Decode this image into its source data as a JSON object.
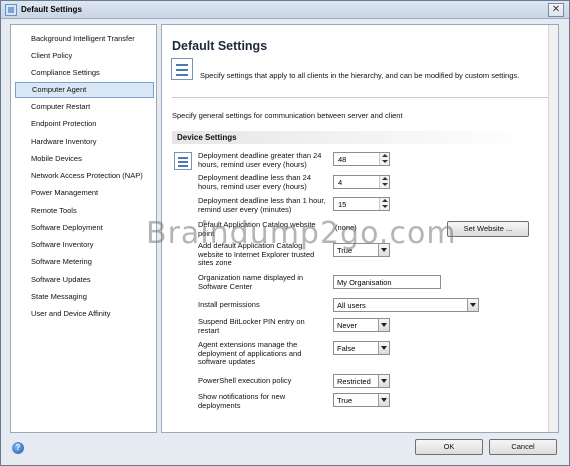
{
  "window": {
    "title": "Default Settings",
    "close_glyph": "✕"
  },
  "sidebar": {
    "items": [
      {
        "label": "Background Intelligent Transfer",
        "selected": false
      },
      {
        "label": "Client Policy",
        "selected": false
      },
      {
        "label": "Compliance Settings",
        "selected": false
      },
      {
        "label": "Computer Agent",
        "selected": true
      },
      {
        "label": "Computer Restart",
        "selected": false
      },
      {
        "label": "Endpoint Protection",
        "selected": false
      },
      {
        "label": "Hardware Inventory",
        "selected": false
      },
      {
        "label": "Mobile Devices",
        "selected": false
      },
      {
        "label": "Network Access Protection (NAP)",
        "selected": false
      },
      {
        "label": "Power Management",
        "selected": false
      },
      {
        "label": "Remote Tools",
        "selected": false
      },
      {
        "label": "Software Deployment",
        "selected": false
      },
      {
        "label": "Software Inventory",
        "selected": false
      },
      {
        "label": "Software Metering",
        "selected": false
      },
      {
        "label": "Software Updates",
        "selected": false
      },
      {
        "label": "State Messaging",
        "selected": false
      },
      {
        "label": "User and Device Affinity",
        "selected": false
      }
    ]
  },
  "main": {
    "title": "Default Settings",
    "description": "Specify settings that apply to all clients in the hierarchy, and can be modified by custom settings.",
    "subheading": "Specify general settings for communication between server and client",
    "section_header": "Device Settings",
    "settings": [
      {
        "label": "Deployment deadline greater than 24 hours, remind user every (hours)",
        "value": "48"
      },
      {
        "label": "Deployment deadline less than 24 hours, remind user every (hours)",
        "value": "4"
      },
      {
        "label": "Deployment deadline less than 1 hour, remind user every (minutes)",
        "value": "15"
      },
      {
        "label": "Default Application Catalog website point",
        "value": "(none)",
        "button": "Set Website ..."
      },
      {
        "label": "Add default Application Catalog website to Internet Explorer trusted sites zone",
        "value": "True"
      },
      {
        "label": "Organization name displayed in Software Center",
        "value": "My Organisation"
      },
      {
        "label": "Install permissions",
        "value": "All users"
      },
      {
        "label": "Suspend BitLocker PIN entry on restart",
        "value": "Never"
      },
      {
        "label": "Agent extensions manage the deployment of applications and software updates",
        "value": "False"
      },
      {
        "label": "PowerShell execution policy",
        "value": "Restricted"
      },
      {
        "label": "Show notifications for new deployments",
        "value": "True"
      }
    ]
  },
  "footer": {
    "ok_label": "OK",
    "cancel_label": "Cancel",
    "help_glyph": "?"
  },
  "watermark": "Braindump2go.com",
  "colors": {
    "selection": "#d9e6f6",
    "window_bg": "#e6ebf2",
    "accent": "#5178b6"
  }
}
